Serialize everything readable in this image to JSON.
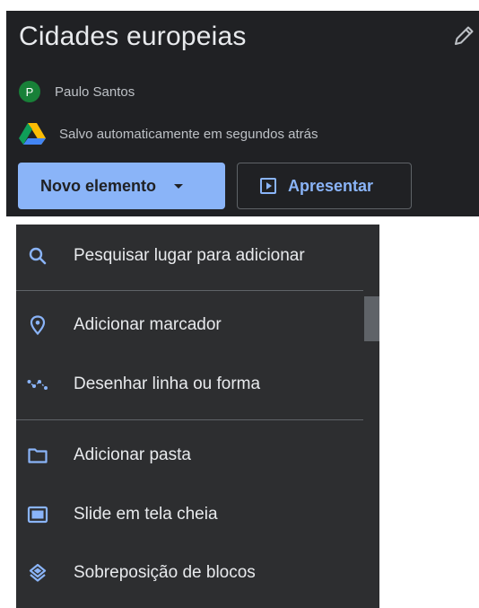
{
  "header": {
    "title": "Cidades europeias",
    "owner": {
      "initial": "P",
      "name": "Paulo Santos"
    },
    "save_status": "Salvo automaticamente em segundos atrás",
    "new_button_label": "Novo elemento",
    "present_button_label": "Apresentar"
  },
  "menu": {
    "items": [
      {
        "label": "Pesquisar lugar para adicionar",
        "icon": "search-icon"
      },
      {
        "label": "Adicionar marcador",
        "icon": "location-pin-icon"
      },
      {
        "label": "Desenhar linha ou forma",
        "icon": "polyline-icon"
      },
      {
        "label": "Adicionar pasta",
        "icon": "folder-icon"
      },
      {
        "label": "Slide em tela cheia",
        "icon": "slide-icon"
      },
      {
        "label": "Sobreposição de blocos",
        "icon": "layers-icon"
      }
    ]
  },
  "colors": {
    "header_bg": "#202124",
    "menu_bg": "#2d2e30",
    "accent": "#8ab4f8",
    "avatar": "#188038"
  }
}
